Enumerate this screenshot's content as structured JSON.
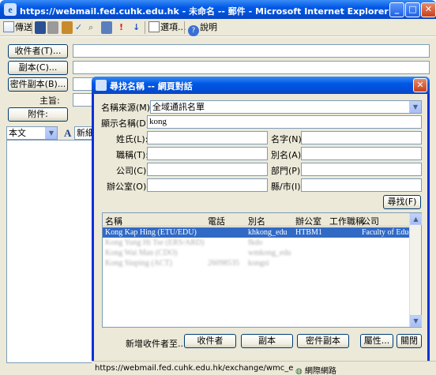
{
  "window": {
    "title": "https://webmail.fed.cuhk.edu.hk - 未命名 -- 郵件 - Microsoft Internet Explorer",
    "minimize": "_",
    "maximize": "□",
    "close": "✕"
  },
  "toolbar": {
    "send": "傳送",
    "options": "選項...",
    "help": "說明"
  },
  "compose": {
    "to_button": "收件者(T)...",
    "cc_button": "副本(C)...",
    "bcc_button": "密件副本(B)...",
    "subject_label": "主旨:",
    "attach_button": "附件:",
    "format_select": "本文",
    "font_select": "新細"
  },
  "dialog": {
    "title": "尋找名稱 -- 網頁對話",
    "source_label": "名稱來源(M):",
    "source_value": "全域通訊名單",
    "display_name_label": "顯示名稱(D)",
    "display_name_value": "kong",
    "last_name_label": "姓氏(L):",
    "first_name_label": "名字(N):",
    "title_label": "職稱(T):",
    "alias_label": "別名(A):",
    "company_label": "公司(C):",
    "department_label": "部門(P):",
    "office_label": "辦公室(O):",
    "city_label": "縣/市(I):",
    "find_button": "尋找(F)",
    "columns": [
      "名稱",
      "電話",
      "別名",
      "辦公室",
      "工作職稱",
      "公司"
    ],
    "results": [
      {
        "name": "Kong Kap Hing (ETU/EDU)",
        "phone": "",
        "alias": "khkong_edu",
        "office": "HTBM1",
        "title": "",
        "company": "Faculty of Educa"
      },
      {
        "name": "Kong Yung Hi Tse (ERS/ARD)",
        "phone": "",
        "alias": "fkdo",
        "office": "",
        "title": "",
        "company": ""
      },
      {
        "name": "Kong Wai Man (CDO)",
        "phone": "",
        "alias": "wmkong_edu",
        "office": "",
        "title": "",
        "company": ""
      },
      {
        "name": "Kong Siuping (ACT)",
        "phone": "26098535",
        "alias": "kongsi",
        "office": "",
        "title": "",
        "company": ""
      }
    ],
    "add_recipients_label": "新增收件者至...",
    "to_button": "收件者",
    "cc_button": "副本",
    "bcc_button": "密件副本",
    "properties_button": "屬性...",
    "close_button": "關閉"
  },
  "statusbar": {
    "url": "https://webmail.fed.cuhk.edu.hk/exchange/wmc_edu?Cmd=dialog&b",
    "zone": "網際網路"
  }
}
